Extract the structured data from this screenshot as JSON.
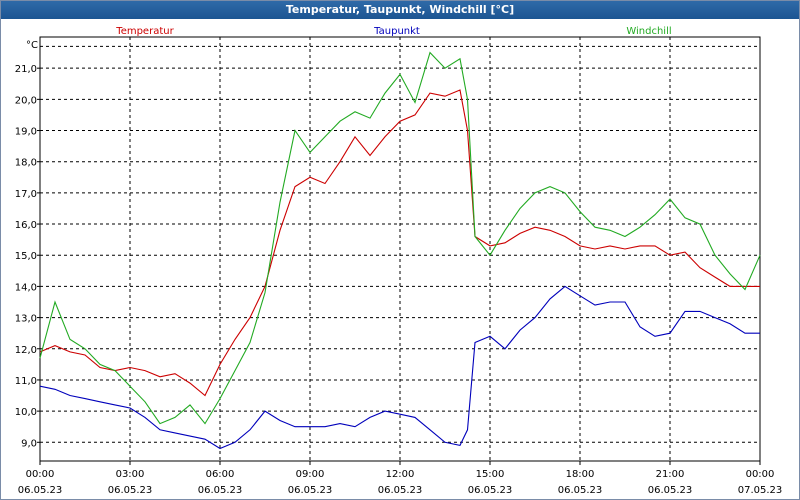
{
  "window": {
    "title": "Temperatur, Taupunkt, Windchill [°C]"
  },
  "chart_data": {
    "type": "line",
    "title": "Temperatur, Taupunkt, Windchill [°C]",
    "ylabel": "°C",
    "xlabel": "",
    "ylim": [
      8.4,
      22.0
    ],
    "xlim": [
      0,
      24
    ],
    "grid": true,
    "legend": "top",
    "y_ticks": [
      "9,0",
      "10,0",
      "11,0",
      "12,0",
      "13,0",
      "14,0",
      "15,0",
      "16,0",
      "17,0",
      "18,0",
      "19,0",
      "20,0",
      "21,0"
    ],
    "x_ticks": [
      {
        "time": "00:00",
        "date": "06.05.23"
      },
      {
        "time": "03:00",
        "date": "06.05.23"
      },
      {
        "time": "06:00",
        "date": "06.05.23"
      },
      {
        "time": "09:00",
        "date": "06.05.23"
      },
      {
        "time": "12:00",
        "date": "06.05.23"
      },
      {
        "time": "15:00",
        "date": "06.05.23"
      },
      {
        "time": "18:00",
        "date": "06.05.23"
      },
      {
        "time": "21:00",
        "date": "06.05.23"
      },
      {
        "time": "00:00",
        "date": "07.05.23"
      }
    ],
    "x": [
      0,
      0.5,
      1,
      1.5,
      2,
      2.5,
      3,
      3.5,
      4,
      4.5,
      5,
      5.5,
      6,
      6.5,
      7,
      7.5,
      8,
      8.5,
      9,
      9.5,
      10,
      10.5,
      11,
      11.5,
      12,
      12.5,
      13,
      13.5,
      14,
      14.25,
      14.5,
      15,
      15.5,
      16,
      16.5,
      17,
      17.5,
      18,
      18.5,
      19,
      19.5,
      20,
      20.5,
      21,
      21.5,
      22,
      22.5,
      23,
      23.5,
      24
    ],
    "series": [
      {
        "name": "Temperatur",
        "color": "#cc0000",
        "values": [
          11.9,
          12.1,
          11.9,
          11.8,
          11.4,
          11.3,
          11.4,
          11.3,
          11.1,
          11.2,
          10.9,
          10.5,
          11.5,
          12.3,
          13.0,
          14.0,
          15.8,
          17.2,
          17.5,
          17.3,
          18.0,
          18.8,
          18.2,
          18.8,
          19.3,
          19.5,
          20.2,
          20.1,
          20.3,
          19.0,
          15.6,
          15.3,
          15.4,
          15.7,
          15.9,
          15.8,
          15.6,
          15.3,
          15.2,
          15.3,
          15.2,
          15.3,
          15.3,
          15.0,
          15.1,
          14.6,
          14.3,
          14.0,
          14.0,
          14.0
        ]
      },
      {
        "name": "Taupunkt",
        "color": "#0000bb",
        "values": [
          10.8,
          10.7,
          10.5,
          10.4,
          10.3,
          10.2,
          10.1,
          9.8,
          9.4,
          9.3,
          9.2,
          9.1,
          8.8,
          9.0,
          9.4,
          10.0,
          9.7,
          9.5,
          9.5,
          9.5,
          9.6,
          9.5,
          9.8,
          10.0,
          9.9,
          9.8,
          9.4,
          9.0,
          8.9,
          9.4,
          12.2,
          12.4,
          12.0,
          12.6,
          13.0,
          13.6,
          14.0,
          13.7,
          13.4,
          13.5,
          13.5,
          12.7,
          12.4,
          12.5,
          13.2,
          13.2,
          13.0,
          12.8,
          12.5,
          12.5
        ]
      },
      {
        "name": "Windchill",
        "color": "#22aa22",
        "values": [
          11.7,
          13.5,
          12.3,
          12.0,
          11.5,
          11.3,
          10.8,
          10.3,
          9.6,
          9.8,
          10.2,
          9.6,
          10.4,
          11.3,
          12.2,
          13.8,
          16.7,
          19.0,
          18.3,
          18.8,
          19.3,
          19.6,
          19.4,
          20.2,
          20.8,
          19.9,
          21.5,
          21.0,
          21.3,
          20.0,
          15.6,
          15.0,
          15.8,
          16.5,
          17.0,
          17.2,
          17.0,
          16.4,
          15.9,
          15.8,
          15.6,
          15.9,
          16.3,
          16.8,
          16.2,
          16.0,
          15.0,
          14.4,
          13.9,
          15.0
        ]
      }
    ]
  }
}
